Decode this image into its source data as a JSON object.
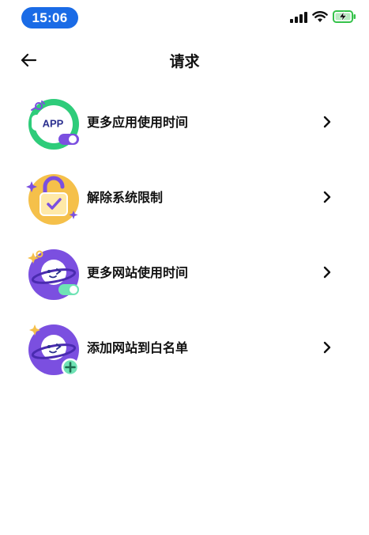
{
  "status_bar": {
    "time": "15:06",
    "icons": [
      "signal-bars-icon",
      "wifi-icon",
      "battery-charging-icon"
    ],
    "time_pill_color": "#1a6be6",
    "battery_color": "#35c24a"
  },
  "header": {
    "title": "请求",
    "back_icon": "arrow-left-icon"
  },
  "requests": [
    {
      "label": "更多应用使用时间",
      "icon": "app-time-icon",
      "icon_text": "APP",
      "chevron": "chevron-right-icon"
    },
    {
      "label": "解除系统限制",
      "icon": "unlock-padlock-icon",
      "chevron": "chevron-right-icon"
    },
    {
      "label": "更多网站使用时间",
      "icon": "planet-toggle-icon",
      "chevron": "chevron-right-icon"
    },
    {
      "label": "添加网站到白名单",
      "icon": "planet-add-icon",
      "chevron": "chevron-right-icon"
    }
  ],
  "colors": {
    "green_ring": "#2ecc7a",
    "purple": "#7b4fe0",
    "yellow": "#f5c04a",
    "mint": "#6fe3b5"
  }
}
